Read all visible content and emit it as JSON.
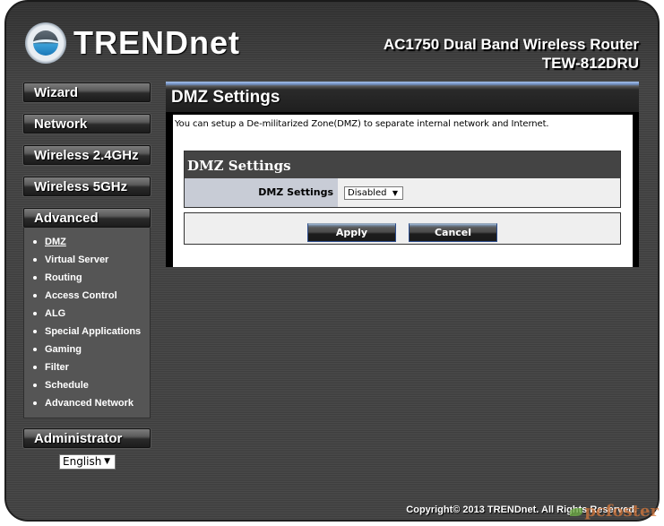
{
  "header": {
    "brand": "TRENDnet",
    "product_title": "AC1750 Dual Band Wireless Router",
    "model": "TEW-812DRU"
  },
  "sidebar": {
    "nav": [
      {
        "label": "Wizard"
      },
      {
        "label": "Network"
      },
      {
        "label": "Wireless 2.4GHz"
      },
      {
        "label": "Wireless 5GHz"
      },
      {
        "label": "Advanced"
      }
    ],
    "advanced_items": [
      {
        "label": "DMZ",
        "active": true
      },
      {
        "label": "Virtual Server"
      },
      {
        "label": "Routing"
      },
      {
        "label": "Access Control"
      },
      {
        "label": "ALG"
      },
      {
        "label": "Special Applications"
      },
      {
        "label": "Gaming"
      },
      {
        "label": "Filter"
      },
      {
        "label": "Schedule"
      },
      {
        "label": "Advanced Network"
      }
    ],
    "administrator": "Administrator",
    "language": {
      "selected": "English"
    }
  },
  "main": {
    "page_title": "DMZ Settings",
    "description": "You can setup a De-militarized Zone(DMZ) to separate internal network and Internet.",
    "section_title": "DMZ Settings",
    "field_label": "DMZ Settings",
    "field_value": "Disabled",
    "apply_label": "Apply",
    "cancel_label": "Cancel"
  },
  "footer": {
    "copyright": "Copyright© 2013 TRENDnet. All Rights Reserved.",
    "watermark": "pcfoster"
  },
  "icons": {
    "dropdown_arrow": "▼"
  }
}
